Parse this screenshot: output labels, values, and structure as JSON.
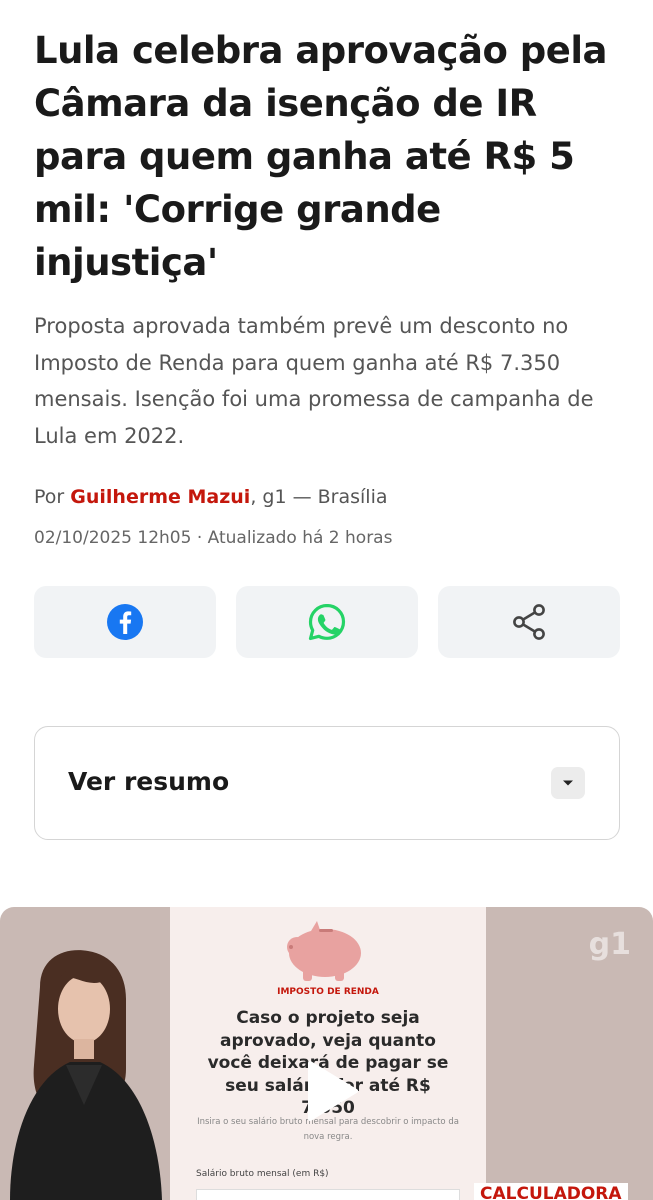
{
  "article": {
    "headline": "Lula celebra aprovação pela Câmara da isenção de IR para quem ganha até R$ 5 mil: 'Corrige grande injustiça'",
    "subtitle": "Proposta aprovada também prevê um desconto no Imposto de Renda para quem ganha até R$ 7.350 mensais. Isenção foi uma promessa de campanha de Lula em 2022.",
    "byline_prefix": "Por ",
    "author": "Guilherme Mazui",
    "byline_suffix": ", g1 — Brasília",
    "dateline": "02/10/2025 12h05 · Atualizado há 2 horas"
  },
  "share": {
    "icons": [
      "facebook-icon",
      "whatsapp-icon",
      "share-icon"
    ],
    "colors": {
      "facebook": "#1877f2",
      "whatsapp": "#25d366",
      "share": "#444444",
      "button_bg": "#f1f3f5"
    }
  },
  "summary": {
    "label": "Ver resumo"
  },
  "video": {
    "tag": "IMPOSTO DE RENDA",
    "card_title": "Caso o projeto seja aprovado, veja quanto você deixará de pagar se seu salário for até R$ 7.350",
    "card_hint": "Insira o seu salário bruto mensal para descobrir o impacto da nova regra.",
    "field_label": "Salário bruto mensal (em R$)",
    "calc_label": "CALCULADORA",
    "watermark": "g1"
  },
  "colors": {
    "accent": "#c4170c",
    "headline": "#1a1a1a",
    "body": "#555555"
  }
}
